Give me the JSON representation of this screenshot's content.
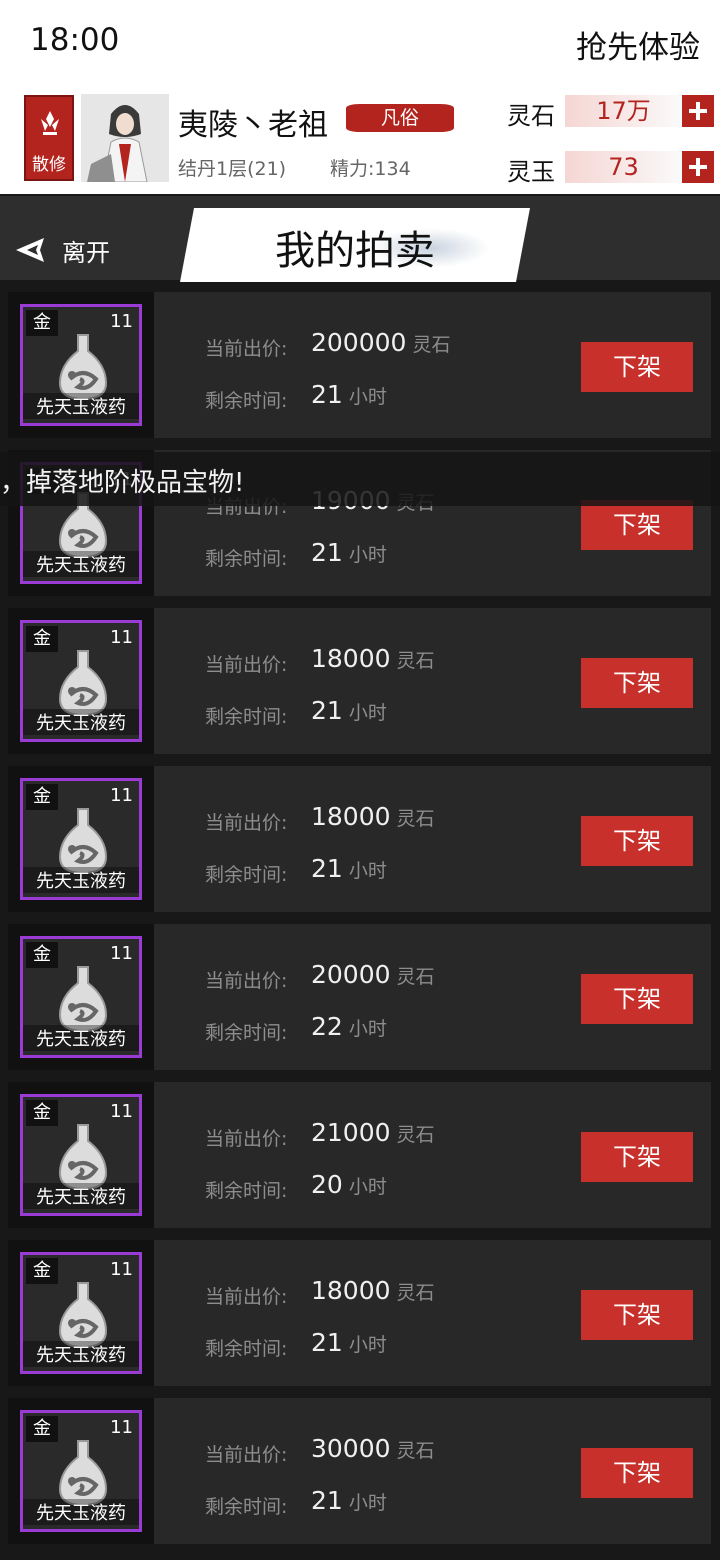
{
  "status": {
    "time": "18:00",
    "promo": "抢先体验"
  },
  "player": {
    "sect_label": "散修",
    "name": "夷陵丶老祖",
    "rank": "凡俗",
    "cultivation": "结丹1层(21)",
    "energy": "精力:134"
  },
  "currencies": [
    {
      "label": "灵石",
      "value": "17万"
    },
    {
      "label": "灵玉",
      "value": "73"
    }
  ],
  "nav": {
    "back_label": "离开",
    "title": "我的拍卖"
  },
  "marquee_text": "，掉落地阶极品宝物!",
  "labels": {
    "price": "当前出价:",
    "remaining": "剩余时间:",
    "price_unit": "灵石",
    "time_unit": "小时",
    "delist": "下架"
  },
  "items": [
    {
      "grade": "金",
      "qty": "11",
      "name": "先天玉液药",
      "price": "200000",
      "hours": "21"
    },
    {
      "grade": "金",
      "qty": "11",
      "name": "先天玉液药",
      "price": "19000",
      "hours": "21"
    },
    {
      "grade": "金",
      "qty": "11",
      "name": "先天玉液药",
      "price": "18000",
      "hours": "21"
    },
    {
      "grade": "金",
      "qty": "11",
      "name": "先天玉液药",
      "price": "18000",
      "hours": "21"
    },
    {
      "grade": "金",
      "qty": "11",
      "name": "先天玉液药",
      "price": "20000",
      "hours": "22"
    },
    {
      "grade": "金",
      "qty": "11",
      "name": "先天玉液药",
      "price": "21000",
      "hours": "20"
    },
    {
      "grade": "金",
      "qty": "11",
      "name": "先天玉液药",
      "price": "18000",
      "hours": "21"
    },
    {
      "grade": "金",
      "qty": "11",
      "name": "先天玉液药",
      "price": "30000",
      "hours": "21"
    }
  ],
  "colors": {
    "accent_red": "#c8302b",
    "rarity_purple": "#9a3bd6"
  }
}
